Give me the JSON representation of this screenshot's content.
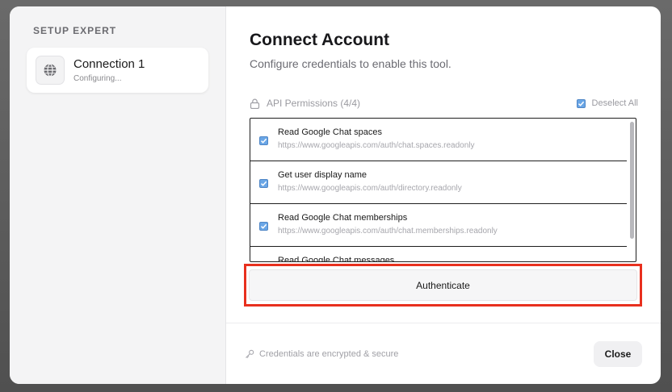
{
  "sidebar": {
    "heading": "SETUP EXPERT",
    "connection": {
      "icon": "globe-icon",
      "title": "Connection 1",
      "status": "Configuring..."
    }
  },
  "main": {
    "title": "Connect Account",
    "subtitle": "Configure credentials to enable this tool.",
    "permissions": {
      "icon": "lock-icon",
      "label": "API Permissions (4/4)",
      "deselect_label": "Deselect All",
      "items": [
        {
          "name": "Read Google Chat spaces",
          "url": "https://www.googleapis.com/auth/chat.spaces.readonly",
          "checked": true
        },
        {
          "name": "Get user display name",
          "url": "https://www.googleapis.com/auth/directory.readonly",
          "checked": true
        },
        {
          "name": "Read Google Chat memberships",
          "url": "https://www.googleapis.com/auth/chat.memberships.readonly",
          "checked": true
        },
        {
          "name": "Read Google Chat messages",
          "url": "",
          "checked": true
        }
      ]
    },
    "authenticate_label": "Authenticate",
    "highlight_color": "#e8301e"
  },
  "footer": {
    "icon": "key-icon",
    "note": "Credentials are encrypted & secure",
    "close_label": "Close"
  },
  "colors": {
    "checkbox": "#6aa6e6",
    "backdrop": "#5a5a5a"
  }
}
